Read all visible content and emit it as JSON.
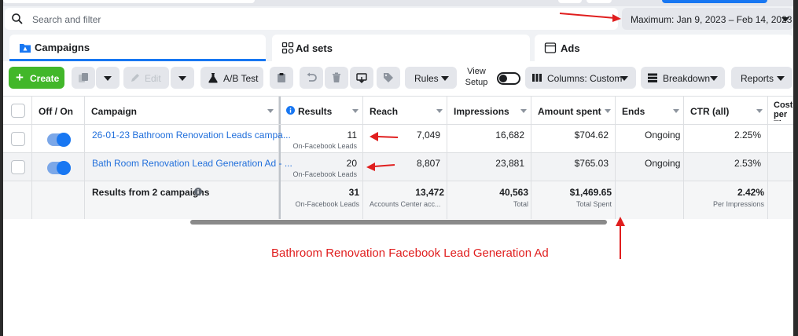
{
  "search": {
    "placeholder": "Search and filter"
  },
  "date_range": {
    "label": "Maximum: Jan 9, 2023 – Feb 14, 2023"
  },
  "tabs": [
    {
      "label": "Campaigns",
      "icon": "folder-icon"
    },
    {
      "label": "Ad sets",
      "icon": "grid-icon"
    },
    {
      "label": "Ads",
      "icon": "ad-page-icon"
    }
  ],
  "toolbar": {
    "create": "Create",
    "edit": "Edit",
    "ab_test": "A/B Test",
    "rules": "Rules",
    "view_setup": "View Setup",
    "columns": "Columns: Custom",
    "breakdown": "Breakdown",
    "reports": "Reports"
  },
  "table": {
    "headers": {
      "onoff": "Off / On",
      "campaign": "Campaign",
      "results": "Results",
      "reach": "Reach",
      "impressions": "Impressions",
      "amount_spent": "Amount spent",
      "ends": "Ends",
      "ctr": "CTR (all)",
      "cost": "Cost per ThruPlay"
    },
    "rows": [
      {
        "campaign": "26-01-23 Bathroom Renovation Leads campa...",
        "results": "11",
        "results_sub": "On-Facebook Leads",
        "reach": "7,049",
        "impressions": "16,682",
        "amount_spent": "$704.62",
        "ends": "Ongoing",
        "ctr": "2.25%",
        "on": true
      },
      {
        "campaign": "Bath Room Renovation Lead Generation Ad - ...",
        "results": "20",
        "results_sub": "On-Facebook Leads",
        "reach": "8,807",
        "impressions": "23,881",
        "amount_spent": "$765.03",
        "ends": "Ongoing",
        "ctr": "2.53%",
        "on": true
      }
    ],
    "totals": {
      "label": "Results from 2 campaigns",
      "results": "31",
      "results_sub": "On-Facebook Leads",
      "reach": "13,472",
      "reach_sub": "Accounts Center acc...",
      "impressions": "40,563",
      "impressions_sub": "Total",
      "amount_spent": "$1,469.65",
      "amount_spent_sub": "Total Spent",
      "ctr": "2.42%",
      "ctr_sub": "Per Impressions"
    }
  },
  "annotation": {
    "text": "Bathroom Renovation Facebook Lead Generation Ad",
    "color": "#e01e1e"
  },
  "colors": {
    "accent": "#1877f2",
    "create": "#42b72a",
    "link": "#216fdb",
    "annotation": "#e01e1e"
  }
}
